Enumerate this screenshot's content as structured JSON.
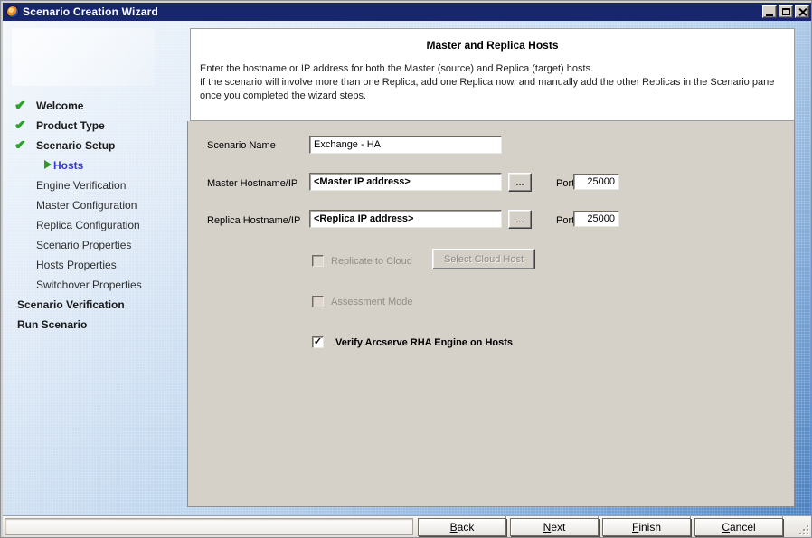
{
  "window": {
    "title": "Scenario Creation Wizard"
  },
  "icons": {
    "app": "arcserve-globe-icon",
    "minimize": "minimize-icon",
    "maximize": "maximize-icon",
    "close": "close-icon",
    "check_glyph": "✔",
    "checkbox_check_glyph": "✓",
    "step_current": "green-arrow-icon",
    "browse_ellipsis": "..."
  },
  "colors": {
    "titlebar": "#17266d",
    "panel_gray": "#d5d1c9",
    "step_done_green": "#2da32d",
    "current_step_blue": "#3434cf",
    "sidebar_gradient_top": "#f3f7fc",
    "sidebar_gradient_bottom": "#4a81c1",
    "disabled_text": "#928e85"
  },
  "sidebar": {
    "steps": [
      {
        "label": "Welcome",
        "state": "done"
      },
      {
        "label": "Product Type",
        "state": "done"
      },
      {
        "label": "Scenario Setup",
        "state": "done"
      },
      {
        "label": "Hosts",
        "state": "current"
      },
      {
        "label": "Engine Verification",
        "state": "pending"
      },
      {
        "label": "Master Configuration",
        "state": "pending"
      },
      {
        "label": "Replica Configuration",
        "state": "pending"
      },
      {
        "label": "Scenario Properties",
        "state": "pending"
      },
      {
        "label": "Hosts Properties",
        "state": "pending"
      },
      {
        "label": "Switchover Properties",
        "state": "pending"
      },
      {
        "label": "Scenario Verification",
        "state": "phase"
      },
      {
        "label": "Run Scenario",
        "state": "phase"
      }
    ]
  },
  "header": {
    "title": "Master and Replica Hosts",
    "desc1": "Enter the hostname or IP address for both the Master (source) and Replica (target) hosts.",
    "desc2": "If the scenario will involve more than one Replica, add one Replica now, and manually add the other Replicas in the Scenario pane once you completed the wizard steps."
  },
  "form": {
    "scenario_name": {
      "label": "Scenario Name",
      "value": "Exchange - HA"
    },
    "master": {
      "label": "Master Hostname/IP",
      "value": "<Master IP address>",
      "browse": "...",
      "port_label": "Port",
      "port_value": "25000"
    },
    "replica": {
      "label": "Replica Hostname/IP",
      "value": "<Replica IP address>",
      "browse": "...",
      "port_label": "Port",
      "port_value": "25000"
    },
    "cloud": {
      "label": "Replicate to Cloud",
      "checked": false,
      "enabled": false,
      "button_label": "Select Cloud Host",
      "button_enabled": false
    },
    "assessment": {
      "label": "Assessment Mode",
      "checked": false,
      "enabled": false
    },
    "verify": {
      "label": "Verify Arcserve RHA Engine on Hosts",
      "checked": true,
      "enabled": true
    }
  },
  "footer": {
    "buttons": [
      {
        "label": "Back"
      },
      {
        "label": "Next"
      },
      {
        "label": "Finish"
      },
      {
        "label": "Cancel"
      }
    ]
  }
}
